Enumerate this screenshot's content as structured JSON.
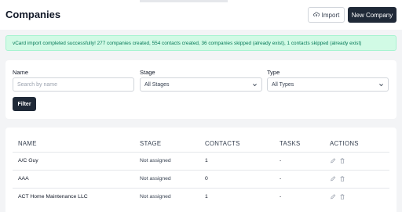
{
  "header": {
    "title": "Companies",
    "import_label": "Import",
    "new_company_label": "New Company"
  },
  "alert": {
    "message": "vCard import completed successfully! 277 companies created, 554 contacts created, 36 companies skipped (already exist), 1 contacts skipped (already exist)"
  },
  "filters": {
    "name_label": "Name",
    "name_placeholder": "Search by name",
    "stage_label": "Stage",
    "stage_value": "All Stages",
    "type_label": "Type",
    "type_value": "All Types",
    "filter_button": "Filter"
  },
  "table": {
    "columns": [
      "NAME",
      "STAGE",
      "CONTACTS",
      "TASKS",
      "ACTIONS"
    ],
    "rows": [
      {
        "name": "A/C Guy",
        "stage": "Not assigned",
        "contacts": "1",
        "tasks": "-"
      },
      {
        "name": "AAA",
        "stage": "Not assigned",
        "contacts": "0",
        "tasks": "-"
      },
      {
        "name": "ACT Home Maintenance LLC",
        "stage": "Not assigned",
        "contacts": "1",
        "tasks": "-"
      }
    ]
  },
  "icons": {
    "import": "upload-cloud-icon",
    "select": "chevron-down-icon",
    "edit": "pencil-icon",
    "delete": "trash-icon"
  },
  "colors": {
    "primary": "#1f2937",
    "alert_bg": "#d1fae5",
    "alert_text": "#047857"
  }
}
